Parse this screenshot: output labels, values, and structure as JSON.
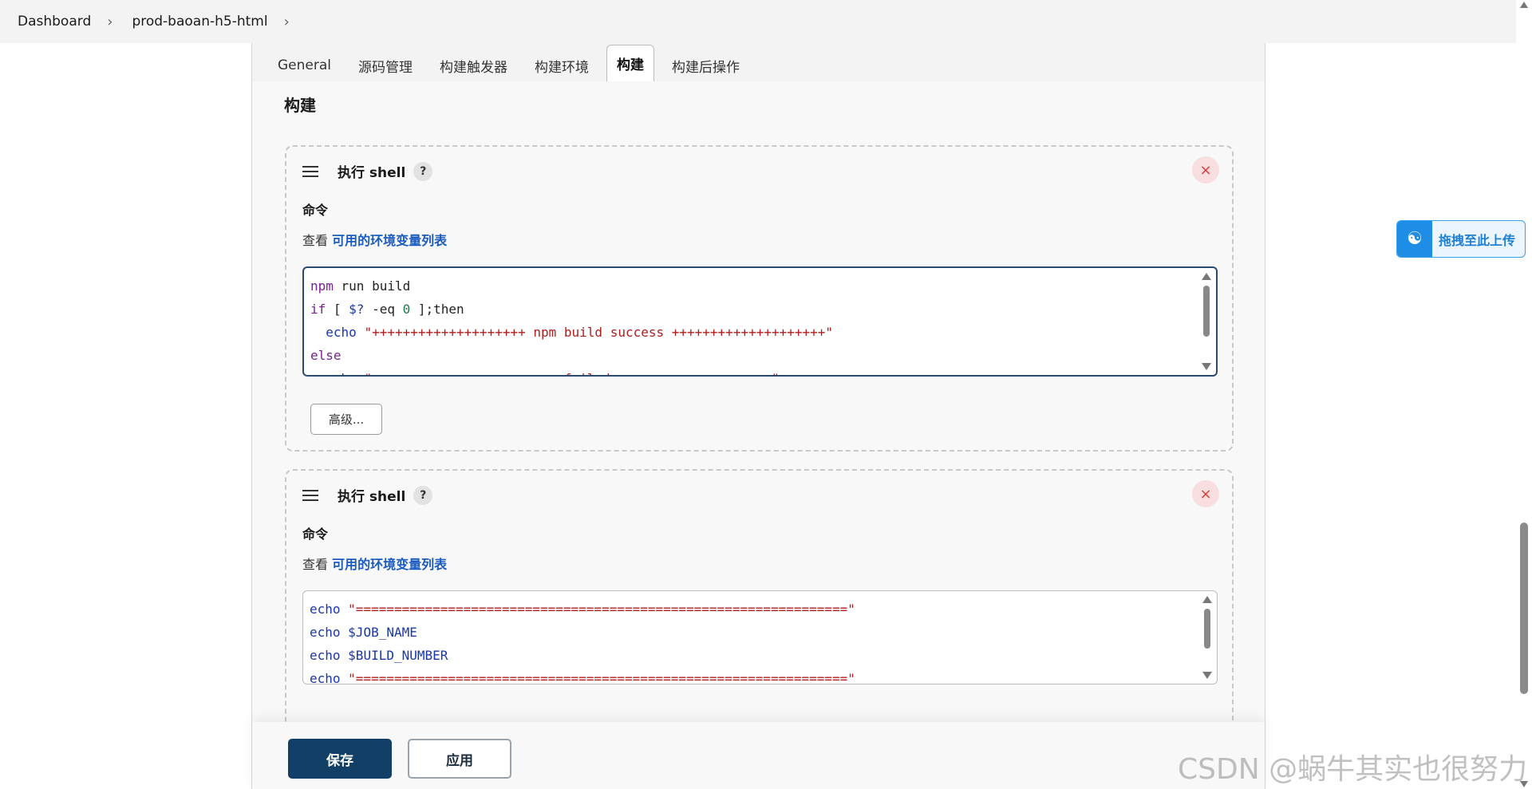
{
  "breadcrumb": {
    "items": [
      "Dashboard",
      "prod-baoan-h5-html"
    ]
  },
  "tabs": [
    {
      "label": "General"
    },
    {
      "label": "源码管理"
    },
    {
      "label": "构建触发器"
    },
    {
      "label": "构建环境"
    },
    {
      "label": "构建",
      "active": true
    },
    {
      "label": "构建后操作"
    }
  ],
  "section": {
    "title": "构建"
  },
  "steps": [
    {
      "title": "执行 shell",
      "help": "?",
      "close": "×",
      "field_label": "命令",
      "env_prefix": "查看",
      "env_link": "可用的环境变量列表",
      "code_lines": [
        "npm run build",
        "if [ $? -eq 0 ];then",
        "  echo \"++++++++++++++++++++ npm build success ++++++++++++++++++++\"",
        "else",
        "  echo \"++++++++++++++++++++ npm failed ++++++++++++++++++++\""
      ],
      "advanced_label": "高级..."
    },
    {
      "title": "执行 shell",
      "help": "?",
      "close": "×",
      "field_label": "命令",
      "env_prefix": "查看",
      "env_link": "可用的环境变量列表",
      "code_lines": [
        "echo \"================================================================\"",
        "echo $JOB_NAME",
        "echo $BUILD_NUMBER",
        "echo \"================================================================\""
      ]
    }
  ],
  "footer": {
    "save_label": "保存",
    "apply_label": "应用"
  },
  "upload_widget": {
    "label": "拖拽至此上传",
    "icon": "cloud-icon"
  },
  "watermark": "CSDN @蜗牛其实也很努力",
  "colors": {
    "primary": "#123f66",
    "link": "#1a5bbd",
    "close_bg": "#f8dede",
    "close_fg": "#d43c3c"
  }
}
